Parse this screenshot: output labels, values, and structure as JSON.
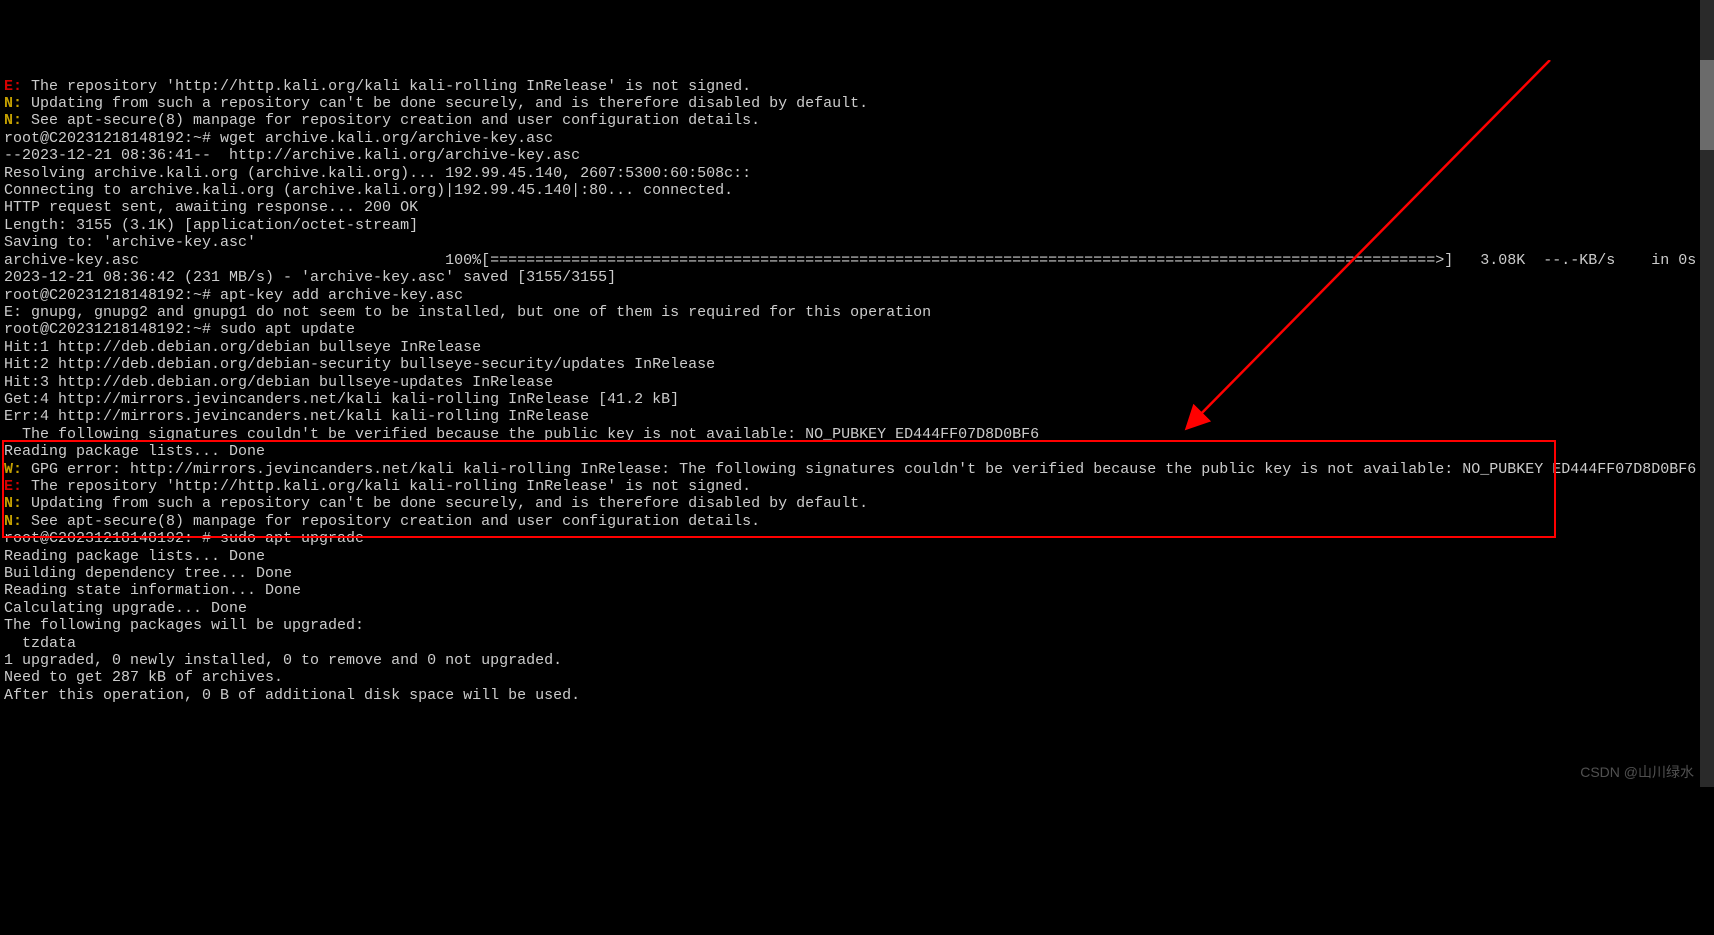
{
  "colors": {
    "bg": "#000000",
    "text": "#cccccc",
    "error": "#d40000",
    "warn": "#c4a000",
    "highlight_border": "#ff0000"
  },
  "watermark": "CSDN @山川绿水",
  "lines": [
    {
      "segs": [
        {
          "c": "err",
          "t": "E:"
        },
        {
          "c": "txt",
          "t": " The repository 'http://http.kali.org/kali kali-rolling InRelease' is not signed."
        }
      ]
    },
    {
      "segs": [
        {
          "c": "warn",
          "t": "N:"
        },
        {
          "c": "txt",
          "t": " Updating from such a repository can't be done securely, and is therefore disabled by default."
        }
      ]
    },
    {
      "segs": [
        {
          "c": "warn",
          "t": "N:"
        },
        {
          "c": "txt",
          "t": " See apt-secure(8) manpage for repository creation and user configuration details."
        }
      ]
    },
    {
      "segs": [
        {
          "c": "txt",
          "t": "root@C20231218148192:~# wget archive.kali.org/archive-key.asc"
        }
      ]
    },
    {
      "segs": [
        {
          "c": "txt",
          "t": "--2023-12-21 08:36:41--  http://archive.kali.org/archive-key.asc"
        }
      ]
    },
    {
      "segs": [
        {
          "c": "txt",
          "t": "Resolving archive.kali.org (archive.kali.org)... 192.99.45.140, 2607:5300:60:508c::"
        }
      ]
    },
    {
      "segs": [
        {
          "c": "txt",
          "t": "Connecting to archive.kali.org (archive.kali.org)|192.99.45.140|:80... connected."
        }
      ]
    },
    {
      "segs": [
        {
          "c": "txt",
          "t": "HTTP request sent, awaiting response... 200 OK"
        }
      ]
    },
    {
      "segs": [
        {
          "c": "txt",
          "t": "Length: 3155 (3.1K) [application/octet-stream]"
        }
      ]
    },
    {
      "segs": [
        {
          "c": "txt",
          "t": "Saving to: 'archive-key.asc'"
        }
      ]
    },
    {
      "segs": [
        {
          "c": "txt",
          "t": ""
        }
      ]
    },
    {
      "segs": [
        {
          "c": "txt",
          "t": "archive-key.asc                                  100%[=========================================================================================================>]   3.08K  --.-KB/s    in 0s"
        }
      ]
    },
    {
      "segs": [
        {
          "c": "txt",
          "t": ""
        }
      ]
    },
    {
      "segs": [
        {
          "c": "txt",
          "t": "2023-12-21 08:36:42 (231 MB/s) - 'archive-key.asc' saved [3155/3155]"
        }
      ]
    },
    {
      "segs": [
        {
          "c": "txt",
          "t": ""
        }
      ]
    },
    {
      "segs": [
        {
          "c": "txt",
          "t": "root@C20231218148192:~# apt-key add archive-key.asc"
        }
      ]
    },
    {
      "segs": [
        {
          "c": "txt",
          "t": "E: gnupg, gnupg2 and gnupg1 do not seem to be installed, but one of them is required for this operation"
        }
      ]
    },
    {
      "segs": [
        {
          "c": "txt",
          "t": "root@C20231218148192:~# sudo apt update"
        }
      ]
    },
    {
      "segs": [
        {
          "c": "txt",
          "t": "Hit:1 http://deb.debian.org/debian bullseye InRelease"
        }
      ]
    },
    {
      "segs": [
        {
          "c": "txt",
          "t": "Hit:2 http://deb.debian.org/debian-security bullseye-security/updates InRelease"
        }
      ]
    },
    {
      "segs": [
        {
          "c": "txt",
          "t": "Hit:3 http://deb.debian.org/debian bullseye-updates InRelease"
        }
      ]
    },
    {
      "segs": [
        {
          "c": "txt",
          "t": "Get:4 http://mirrors.jevincanders.net/kali kali-rolling InRelease [41.2 kB]"
        }
      ]
    },
    {
      "segs": [
        {
          "c": "txt",
          "t": "Err:4 http://mirrors.jevincanders.net/kali kali-rolling InRelease"
        }
      ]
    },
    {
      "segs": [
        {
          "c": "txt",
          "t": "  The following signatures couldn't be verified because the public key is not available: NO_PUBKEY ED444FF07D8D0BF6"
        }
      ]
    },
    {
      "segs": [
        {
          "c": "txt",
          "t": "Reading package lists... Done"
        }
      ]
    },
    {
      "segs": [
        {
          "c": "warn",
          "t": "W:"
        },
        {
          "c": "txt",
          "t": " GPG error: http://mirrors.jevincanders.net/kali kali-rolling InRelease: The following signatures couldn't be verified because the public key is not available: NO_PUBKEY ED444FF07D8D0BF6"
        }
      ]
    },
    {
      "segs": [
        {
          "c": "err",
          "t": "E:"
        },
        {
          "c": "txt",
          "t": " The repository 'http://http.kali.org/kali kali-rolling InRelease' is not signed."
        }
      ]
    },
    {
      "segs": [
        {
          "c": "warn",
          "t": "N:"
        },
        {
          "c": "txt",
          "t": " Updating from such a repository can't be done securely, and is therefore disabled by default."
        }
      ]
    },
    {
      "segs": [
        {
          "c": "warn",
          "t": "N:"
        },
        {
          "c": "txt",
          "t": " See apt-secure(8) manpage for repository creation and user configuration details."
        }
      ]
    },
    {
      "segs": [
        {
          "c": "txt",
          "t": "root@C20231218148192:~# sudo apt upgrade"
        }
      ]
    },
    {
      "segs": [
        {
          "c": "txt",
          "t": "Reading package lists... Done"
        }
      ]
    },
    {
      "segs": [
        {
          "c": "txt",
          "t": "Building dependency tree... Done"
        }
      ]
    },
    {
      "segs": [
        {
          "c": "txt",
          "t": "Reading state information... Done"
        }
      ]
    },
    {
      "segs": [
        {
          "c": "txt",
          "t": "Calculating upgrade... Done"
        }
      ]
    },
    {
      "segs": [
        {
          "c": "txt",
          "t": "The following packages will be upgraded:"
        }
      ]
    },
    {
      "segs": [
        {
          "c": "txt",
          "t": "  tzdata"
        }
      ]
    },
    {
      "segs": [
        {
          "c": "txt",
          "t": "1 upgraded, 0 newly installed, 0 to remove and 0 not upgraded."
        }
      ]
    },
    {
      "segs": [
        {
          "c": "txt",
          "t": "Need to get 287 kB of archives."
        }
      ]
    },
    {
      "segs": [
        {
          "c": "txt",
          "t": "After this operation, 0 B of additional disk space will be used."
        }
      ]
    }
  ]
}
